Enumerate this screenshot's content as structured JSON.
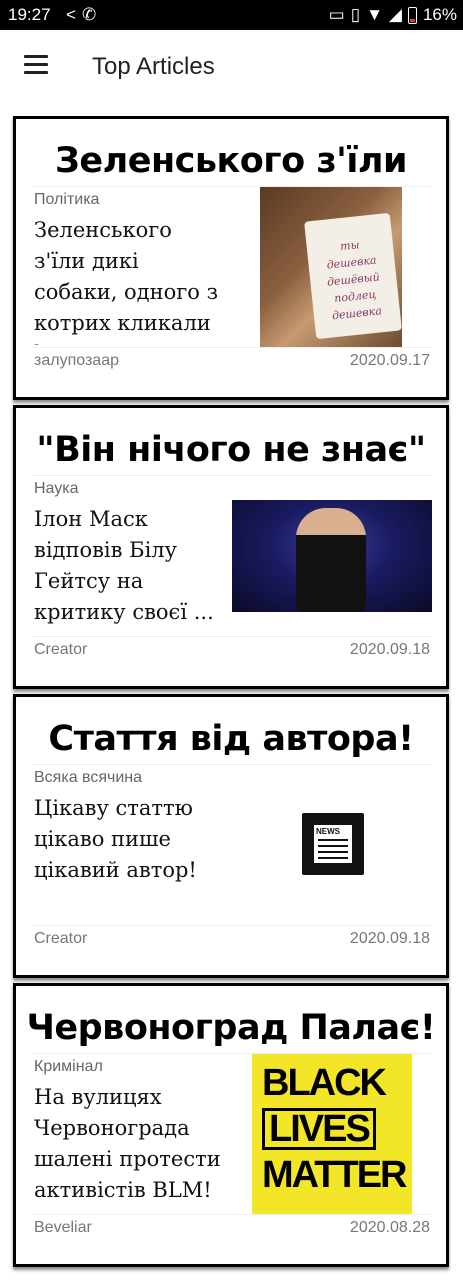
{
  "status_bar": {
    "time": "19:27",
    "battery_percent": "16%",
    "icons_left": [
      "share-icon",
      "viber-icon"
    ],
    "icons_right": [
      "cast-icon",
      "vibrate-icon",
      "wifi-icon",
      "signal-icon",
      "battery-icon"
    ]
  },
  "app_bar": {
    "title": "Top Articles",
    "menu_icon": "hamburger-menu-icon"
  },
  "articles": [
    {
      "headline": "Зеленського з'їли",
      "category": "Політика",
      "summary": "Зеленського з'їли дикі собаки, одного з котрих кликали l...",
      "author": "залупозаар",
      "date": "2020.09.17",
      "image": "photo-man-with-poster",
      "poster_text": [
        "ты",
        "дешевка",
        "дешёвый",
        "подлец",
        "дешевка"
      ]
    },
    {
      "headline": "\"Він нічого не знає\"",
      "category": "Наука",
      "summary": "Ілон Маск відповів Білу Гейтсу на критику своєї ...",
      "author": "Creator",
      "date": "2020.09.18",
      "image": "photo-speaker-on-stage"
    },
    {
      "headline": "Стаття від автора!",
      "category": "Всяка всячина",
      "summary": "Цікаву статтю цікаво пише цікавий автор!",
      "author": "Creator",
      "date": "2020.09.18",
      "image": "newspaper-icon"
    },
    {
      "headline": "Червоноград Палає!",
      "category": "Кримінал",
      "summary": "На вулицях Червонограда шалені протести активістів BLM!",
      "author": "Beveliar",
      "date": "2020.08.28",
      "image": "black-lives-matter-poster",
      "poster_lines": [
        "BLACK",
        "LIVES",
        "MATTER"
      ]
    }
  ],
  "colors": {
    "status_bar_bg": "#000000",
    "card_border": "#000000",
    "blm_yellow": "#f3e629",
    "meta_text": "#777777"
  }
}
